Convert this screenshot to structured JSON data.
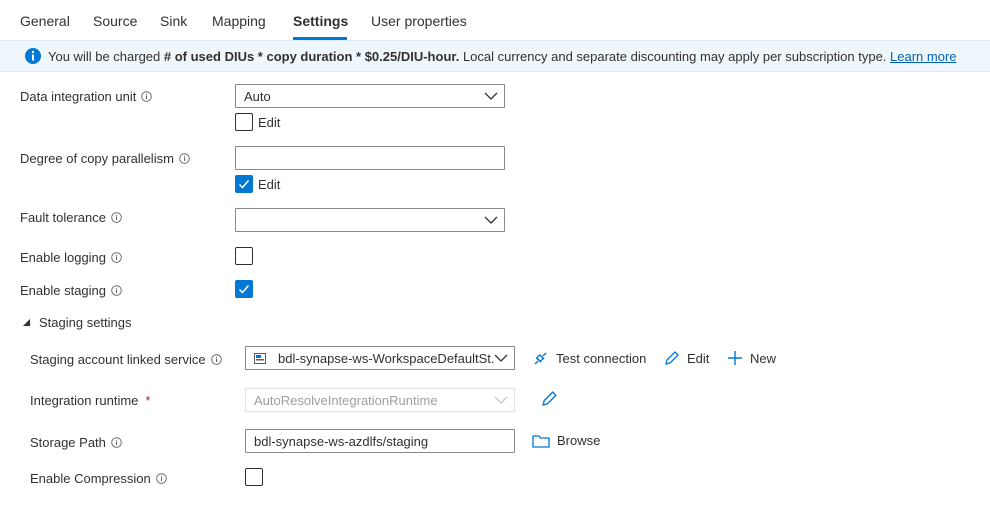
{
  "tabs": [
    {
      "label": "General"
    },
    {
      "label": "Source"
    },
    {
      "label": "Sink"
    },
    {
      "label": "Mapping"
    },
    {
      "label": "Settings"
    },
    {
      "label": "User properties"
    }
  ],
  "banner": {
    "prefix": "You will be charged ",
    "bold": "# of used DIUs * copy duration * $0.25/DIU-hour.",
    "suffix": " Local currency and separate discounting may apply per subscription type. ",
    "link": "Learn more"
  },
  "fields": {
    "diu": {
      "label": "Data integration unit",
      "value": "Auto",
      "edit_label": "Edit"
    },
    "parallelism": {
      "label": "Degree of copy parallelism",
      "value": "",
      "edit_label": "Edit"
    },
    "fault_tolerance": {
      "label": "Fault tolerance",
      "value": ""
    },
    "logging": {
      "label": "Enable logging"
    },
    "staging": {
      "label": "Enable staging"
    }
  },
  "staging_settings": {
    "title": "Staging settings",
    "linked_service": {
      "label": "Staging account linked service",
      "value": "bdl-synapse-ws-WorkspaceDefaultSt...",
      "test_connection": "Test connection",
      "edit": "Edit",
      "new": "New"
    },
    "integration_runtime": {
      "label": "Integration runtime",
      "required_mark": "*",
      "value": "AutoResolveIntegrationRuntime"
    },
    "storage_path": {
      "label": "Storage Path",
      "value": "bdl-synapse-ws-azdlfs/staging",
      "browse": "Browse"
    },
    "compression": {
      "label": "Enable Compression"
    }
  },
  "colors": {
    "accent": "#0078d4",
    "banner_bg": "#eff6fc",
    "required": "#a4262c"
  }
}
